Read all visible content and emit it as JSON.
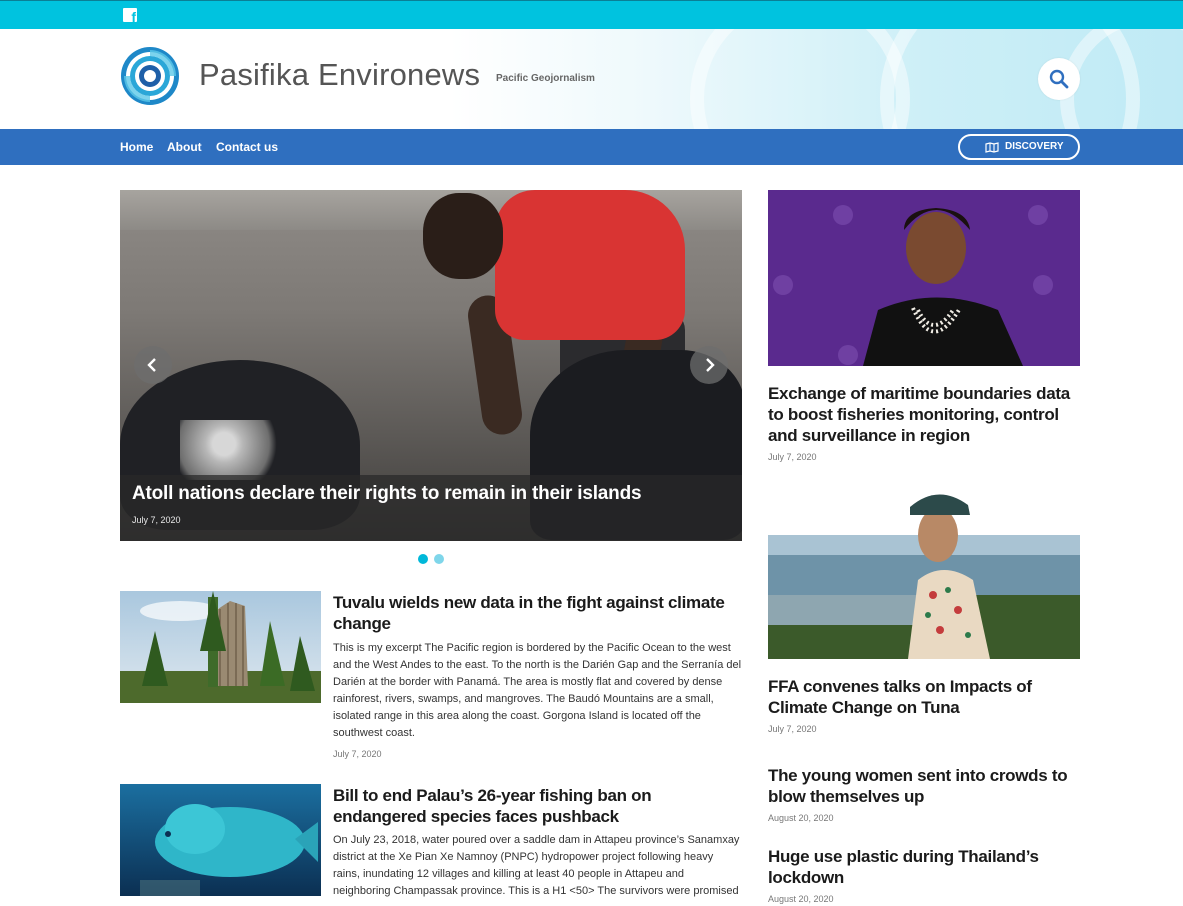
{
  "topbar": {
    "social_icon": "facebook-icon"
  },
  "header": {
    "site_title": "Pasifika Environews",
    "tagline": "Pacific Geojornalism",
    "search_icon": "search-icon"
  },
  "nav": {
    "items": [
      {
        "label": "Home"
      },
      {
        "label": "About"
      },
      {
        "label": "Contact us"
      }
    ],
    "discovery_label": "DISCOVERY",
    "discovery_icon": "map-icon"
  },
  "hero": {
    "title": "Atoll nations declare their rights to remain in their islands",
    "date": "July 7, 2020",
    "prev_icon": "chevron-left-icon",
    "next_icon": "chevron-right-icon",
    "slides_total": 2,
    "active_slide": 1
  },
  "articles": [
    {
      "title": "Tuvalu wields new data in the fight against climate change",
      "excerpt": "This is my excerpt The Pacific region is bordered by the Pacific Ocean to the west and the West Andes to the east. To the north is the Darién Gap and the Serranía del Darién at the border with Panamá. The area is mostly flat and covered by dense rainforest, rivers, swamps, and mangroves. The Baudó Mountains are a small, isolated range in this area along the coast. Gorgona Island is located off the southwest coast.",
      "date": "July 7, 2020"
    },
    {
      "title": "Bill to end Palau’s 26-year fishing ban on endangered species faces pushback",
      "excerpt": "On July 23, 2018, water poured over a saddle dam in Attapeu province’s Sanamxay district at the Xe Pian Xe Namnoy (PNPC) hydropower project following heavy rains, inundating 12 villages and killing at least 40 people in Attapeu and neighboring Champassak province. This is a H1 <50> The survivors were promised",
      "date": ""
    }
  ],
  "sidebar": [
    {
      "title": "Exchange of maritime boundaries data to boost fisheries monitoring, control and surveillance in region",
      "date": "July 7, 2020"
    },
    {
      "title": "FFA convenes talks on Impacts of Climate Change on Tuna",
      "date": "July 7, 2020"
    },
    {
      "title": "The young women sent into crowds to blow themselves up",
      "date": "August 20, 2020"
    },
    {
      "title": "Huge use plastic during Thailand’s lockdown",
      "date": "August 20, 2020"
    }
  ],
  "colors": {
    "topbar": "#00c3df",
    "navbar": "#2f6fbf",
    "dot_active": "#00b8d9",
    "dot_inactive": "#7fd6ea"
  }
}
